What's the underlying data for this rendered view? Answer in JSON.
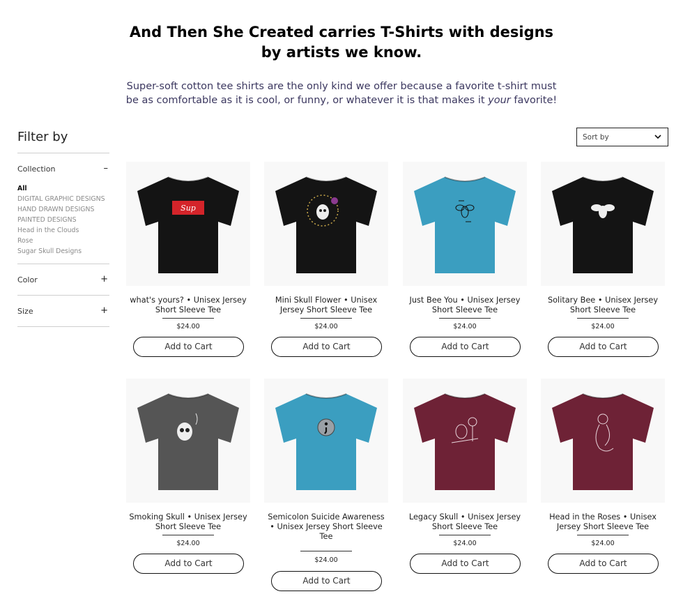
{
  "hero": {
    "title_line1": "And Then She Created carries T-Shirts with designs",
    "title_line2": "by artists we know.",
    "subtitle_line1": "Super-soft cotton tee shirts are the only kind we offer because a favorite t-shirt must",
    "subtitle_line2_a": "be as comfortable as it is cool, or funny, or whatever it is that makes it ",
    "subtitle_line2_em": "your",
    "subtitle_line2_b": " favorite!"
  },
  "filters": {
    "title": "Filter by",
    "collection": {
      "label": "Collection",
      "toggle": "–"
    },
    "collection_items": [
      "All",
      "DIGITAL GRAPHIC DESIGNS",
      "HAND DRAWN DESIGNS",
      "PAINTED DESIGNS",
      "Head in the Clouds",
      "Rose",
      "Sugar Skull Designs"
    ],
    "color": {
      "label": "Color",
      "toggle": "+"
    },
    "size": {
      "label": "Size",
      "toggle": "+"
    }
  },
  "sort": {
    "label": "Sort by",
    "chevron": "⌄"
  },
  "products": [
    {
      "name1": "what's yours? • Unisex Jersey",
      "name2": "Short Sleeve Tee",
      "name3": "",
      "price": "$24.00",
      "button": "Add to Cart",
      "color": "#141414",
      "design": "supreme-box-logo",
      "design_text": "Sup"
    },
    {
      "name1": "Mini Skull Flower • Unisex",
      "name2": "Jersey Short Sleeve Tee",
      "name3": "",
      "price": "$24.00",
      "button": "Add to Cart",
      "color": "#141414",
      "design": "skull-flower"
    },
    {
      "name1": "Just Bee You • Unisex Jersey",
      "name2": "Short Sleeve Tee",
      "name3": "",
      "price": "$24.00",
      "button": "Add to Cart",
      "color": "#3b9ec0",
      "design": "bee-text"
    },
    {
      "name1": "Solitary Bee • Unisex Jersey",
      "name2": "Short Sleeve Tee",
      "name3": "",
      "price": "$24.00",
      "button": "Add to Cart",
      "color": "#141414",
      "design": "bee-white"
    },
    {
      "name1": "Smoking Skull • Unisex Jersey",
      "name2": "Short Sleeve Tee",
      "name3": "",
      "price": "$24.00",
      "button": "Add to Cart",
      "color": "#555555",
      "design": "smoking-skull"
    },
    {
      "name1": "Semicolon Suicide Awareness",
      "name2": "• Unisex Jersey Short Sleeve",
      "name3": "Tee",
      "price": "$24.00",
      "button": "Add to Cart",
      "color": "#3b9ec0",
      "design": "semicolon-badge"
    },
    {
      "name1": "Legacy Skull • Unisex Jersey",
      "name2": "Short Sleeve Tee",
      "name3": "",
      "price": "$24.00",
      "button": "Add to Cart",
      "color": "#6e2236",
      "design": "legacy-skull"
    },
    {
      "name1": "Head in the Roses • Unisex",
      "name2": "Jersey Short Sleeve Tee",
      "name3": "",
      "price": "$24.00",
      "button": "Add to Cart",
      "color": "#6e2236",
      "design": "rose-head"
    }
  ]
}
